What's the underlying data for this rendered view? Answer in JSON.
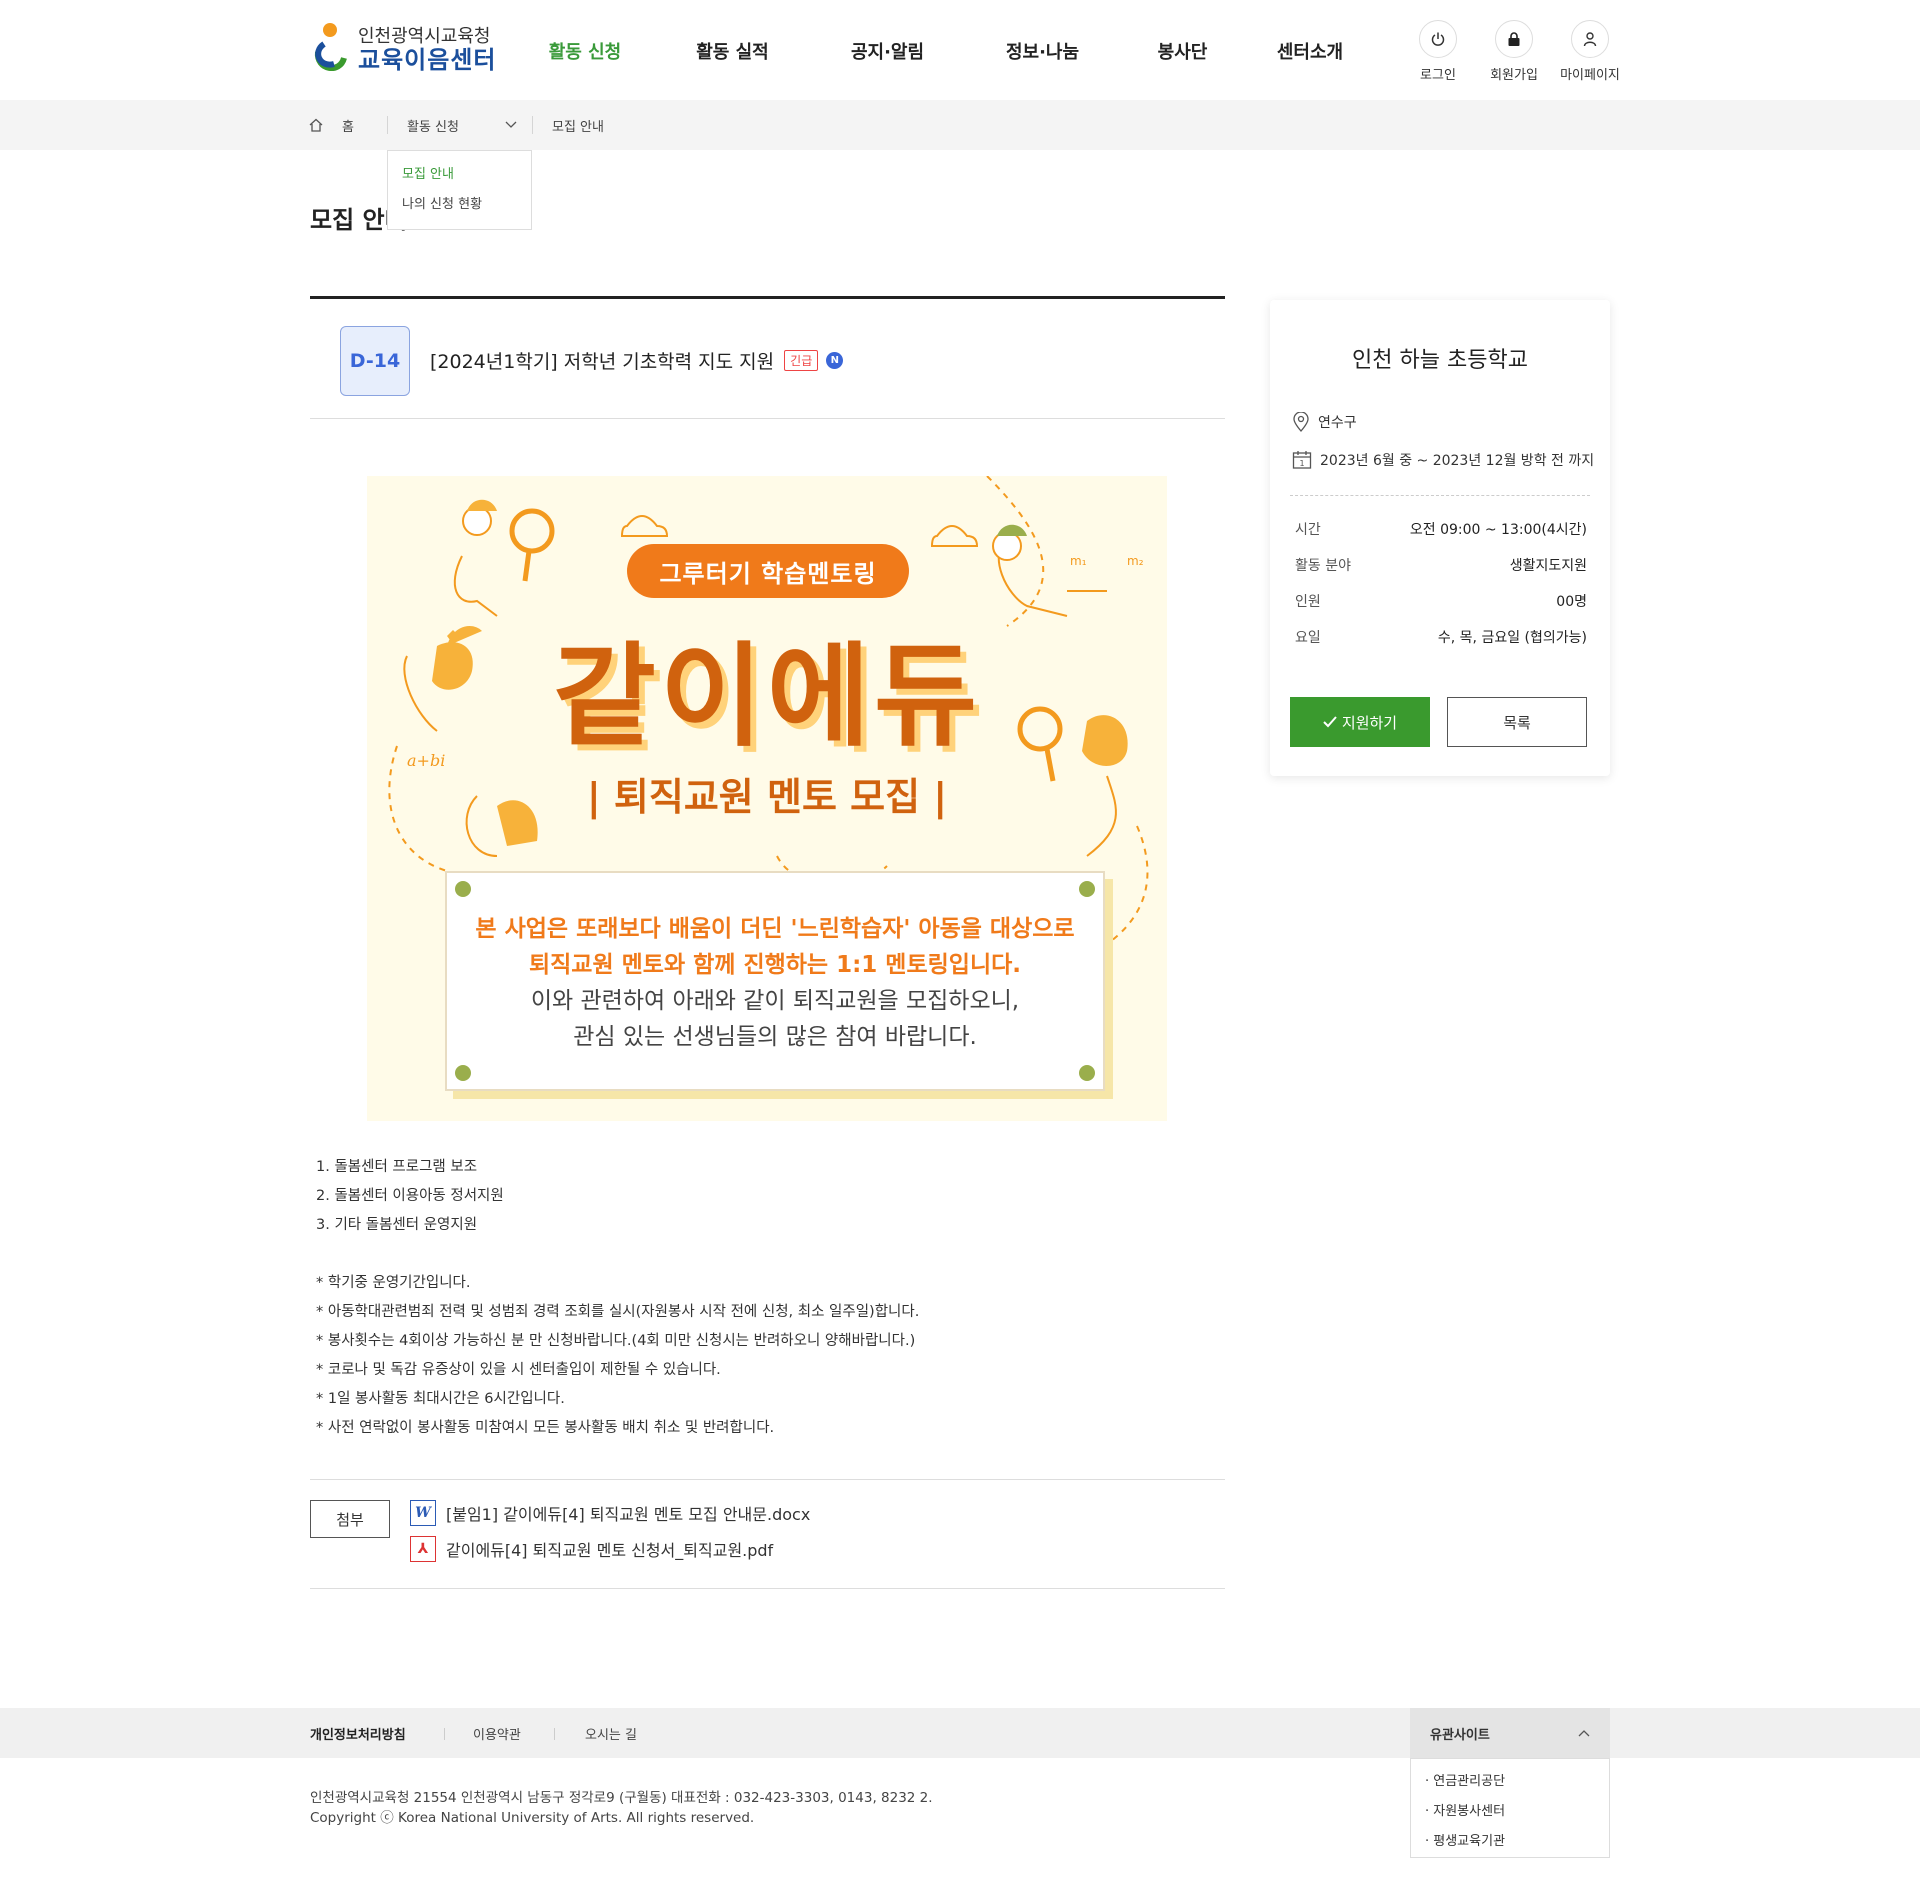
{
  "header": {
    "logo_top": "인천광역시교육청",
    "logo_bottom": "교육이음센터",
    "nav": [
      "활동 신청",
      "활동 실적",
      "공지·알림",
      "정보·나눔",
      "봉사단",
      "센터소개"
    ],
    "util": {
      "login": "로그인",
      "join": "회원가입",
      "mypage": "마이페이지"
    }
  },
  "breadcrumb": {
    "home": "홈",
    "section": "활동 신청",
    "current": "모집 안내",
    "dropdown": [
      "모집 안내",
      "나의 신청 현황"
    ]
  },
  "page_title": "모집 안내",
  "post": {
    "dday": "D-14",
    "title": "[2024년1학기] 저학년 기초학력 지도 지원",
    "urgent_badge": "긴급",
    "new_badge": "N"
  },
  "poster": {
    "pill": "그루터기 학습멘토링",
    "big": "같이에듀",
    "sub": "| 퇴직교원 멘토 모집 |",
    "lines_orange": [
      "본 사업은 또래보다 배움이 더딘 '느린학습자' 아동을 대상으로",
      "퇴직교원 멘토와 함께 진행하는 1:1 멘토링입니다."
    ],
    "lines_gray": [
      "이와 관련하여 아래와 같이 퇴직교원을 모집하오니,",
      "관심 있는 선생님들의 많은 참여 바랍니다."
    ],
    "formula": "a+bi",
    "m1": "m₁",
    "m2": "m₂"
  },
  "body": {
    "items": [
      "1. 돌봄센터 프로그램 보조",
      "2. 돌봄센터 이용아동 정서지원",
      "3. 기타 돌봄센터 운영지원"
    ],
    "notes": [
      "* 학기중 운영기간입니다.",
      "* 아동학대관련범죄 전력 및 성범죄 경력 조회를 실시(자원봉사 시작 전에 신청, 최소 일주일)합니다.",
      "* 봉사횟수는 4회이상 가능하신 분 만 신청바랍니다.(4회 미만 신청시는 반려하오니 양해바랍니다.)",
      "* 코로나 및 독감 유증상이 있을 시 센터출입이 제한될 수 있습니다.",
      "* 1일 봉사활동 최대시간은 6시간입니다.",
      "* 사전 연락없이 봉사활동 미참여시 모든 봉사활동 배치 취소 및 반려합니다."
    ]
  },
  "attachments": {
    "label": "첨부",
    "files": [
      "[붙임1] 같이에듀[4] 퇴직교원 멘토 모집 안내문.docx",
      "같이에듀[4] 퇴직교원 멘토 신청서_퇴직교원.pdf"
    ],
    "icons": [
      "W",
      "⅄"
    ]
  },
  "card": {
    "school": "인천 하늘 초등학교",
    "location": "연수구",
    "period": "2023년 6월 중 ~ 2023년 12월 방학 전 까지",
    "calendar_day": "1",
    "rows": [
      {
        "k": "시간",
        "v": "오전 09:00 ~ 13:00(4시간)"
      },
      {
        "k": "활동 분야",
        "v": "생활지도지원"
      },
      {
        "k": "인원",
        "v": "00명"
      },
      {
        "k": "요일",
        "v": "수, 목, 금요일 (협의가능)"
      }
    ],
    "apply": "지원하기",
    "list": "목록"
  },
  "footer": {
    "links": [
      "개인정보처리방침",
      "이용약관",
      "오시는 길"
    ],
    "related_title": "유관사이트",
    "related": [
      "· 연금관리공단",
      "· 자원봉사센터",
      "· 평생교육기관"
    ],
    "address": "인천광역시교육청 21554 인천광역시 남동구 정각로9 (구월동) 대표전화 : 032-423-3303, 0143, 8232 2.",
    "copyright": "Copyright ⓒ Korea National University of Arts. All rights reserved."
  },
  "colors": {
    "accent_green": "#3a9a2e",
    "dday_blue": "#3a66d8",
    "poster_orange": "#f07a1a",
    "urgent_red": "#e44444"
  }
}
